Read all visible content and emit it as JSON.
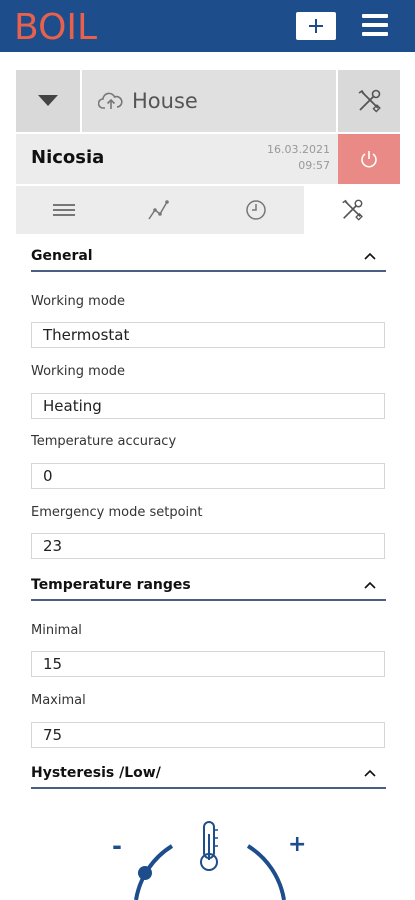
{
  "app": {
    "logo_text": "BOIL",
    "brand_color": "#1e4d8c",
    "logo_color": "#e8614d"
  },
  "header": {
    "location_group": "House",
    "location_name": "Nicosia",
    "date": "16.03.2021",
    "time": "09:57",
    "power_color": "#e98a86"
  },
  "tabs": [
    {
      "icon": "list-icon"
    },
    {
      "icon": "chart-icon"
    },
    {
      "icon": "clock-icon"
    },
    {
      "icon": "tools-icon",
      "active": true
    }
  ],
  "sections": {
    "general": {
      "title": "General",
      "fields": [
        {
          "label": "Working mode",
          "value": "Thermostat"
        },
        {
          "label": "Working mode",
          "value": "Heating"
        },
        {
          "label": "Temperature accuracy",
          "value": "0"
        },
        {
          "label": "Emergency mode setpoint",
          "value": "23"
        }
      ]
    },
    "temperature_ranges": {
      "title": "Temperature ranges",
      "fields": [
        {
          "label": "Minimal",
          "value": "15"
        },
        {
          "label": "Maximal",
          "value": "75"
        }
      ]
    },
    "hysteresis": {
      "title": "Hysteresis /Low/"
    }
  },
  "gauge": {
    "minus": "-",
    "plus": "+"
  }
}
